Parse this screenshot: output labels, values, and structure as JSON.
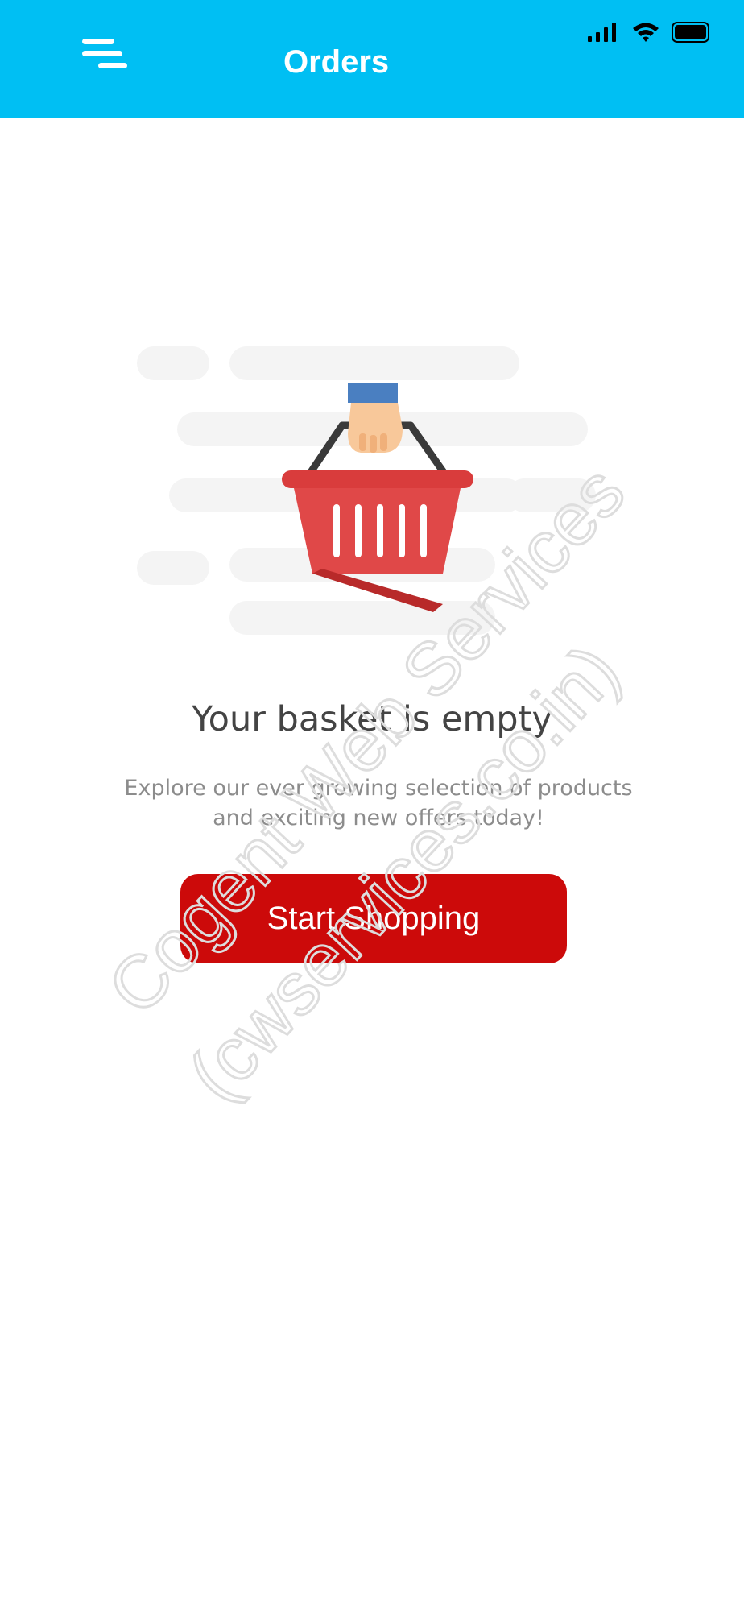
{
  "header": {
    "title": "Orders",
    "background_color": "#00bff3",
    "menu_icon": "hamburger-menu-icon"
  },
  "status_bar": {
    "icons": [
      "cellular-signal-icon",
      "wifi-icon",
      "battery-icon"
    ]
  },
  "empty_state": {
    "illustration": "basket-in-hand-icon",
    "heading": "Your basket is empty",
    "description_line1": "Explore our ever growing selection of products",
    "description_line2": "and exciting new offers today!",
    "button_label": "Start Shopping",
    "button_color": "#cc0a0a"
  },
  "watermark": {
    "line1": "Cogent Web Services",
    "line2": "(cwservices.co.in)"
  }
}
